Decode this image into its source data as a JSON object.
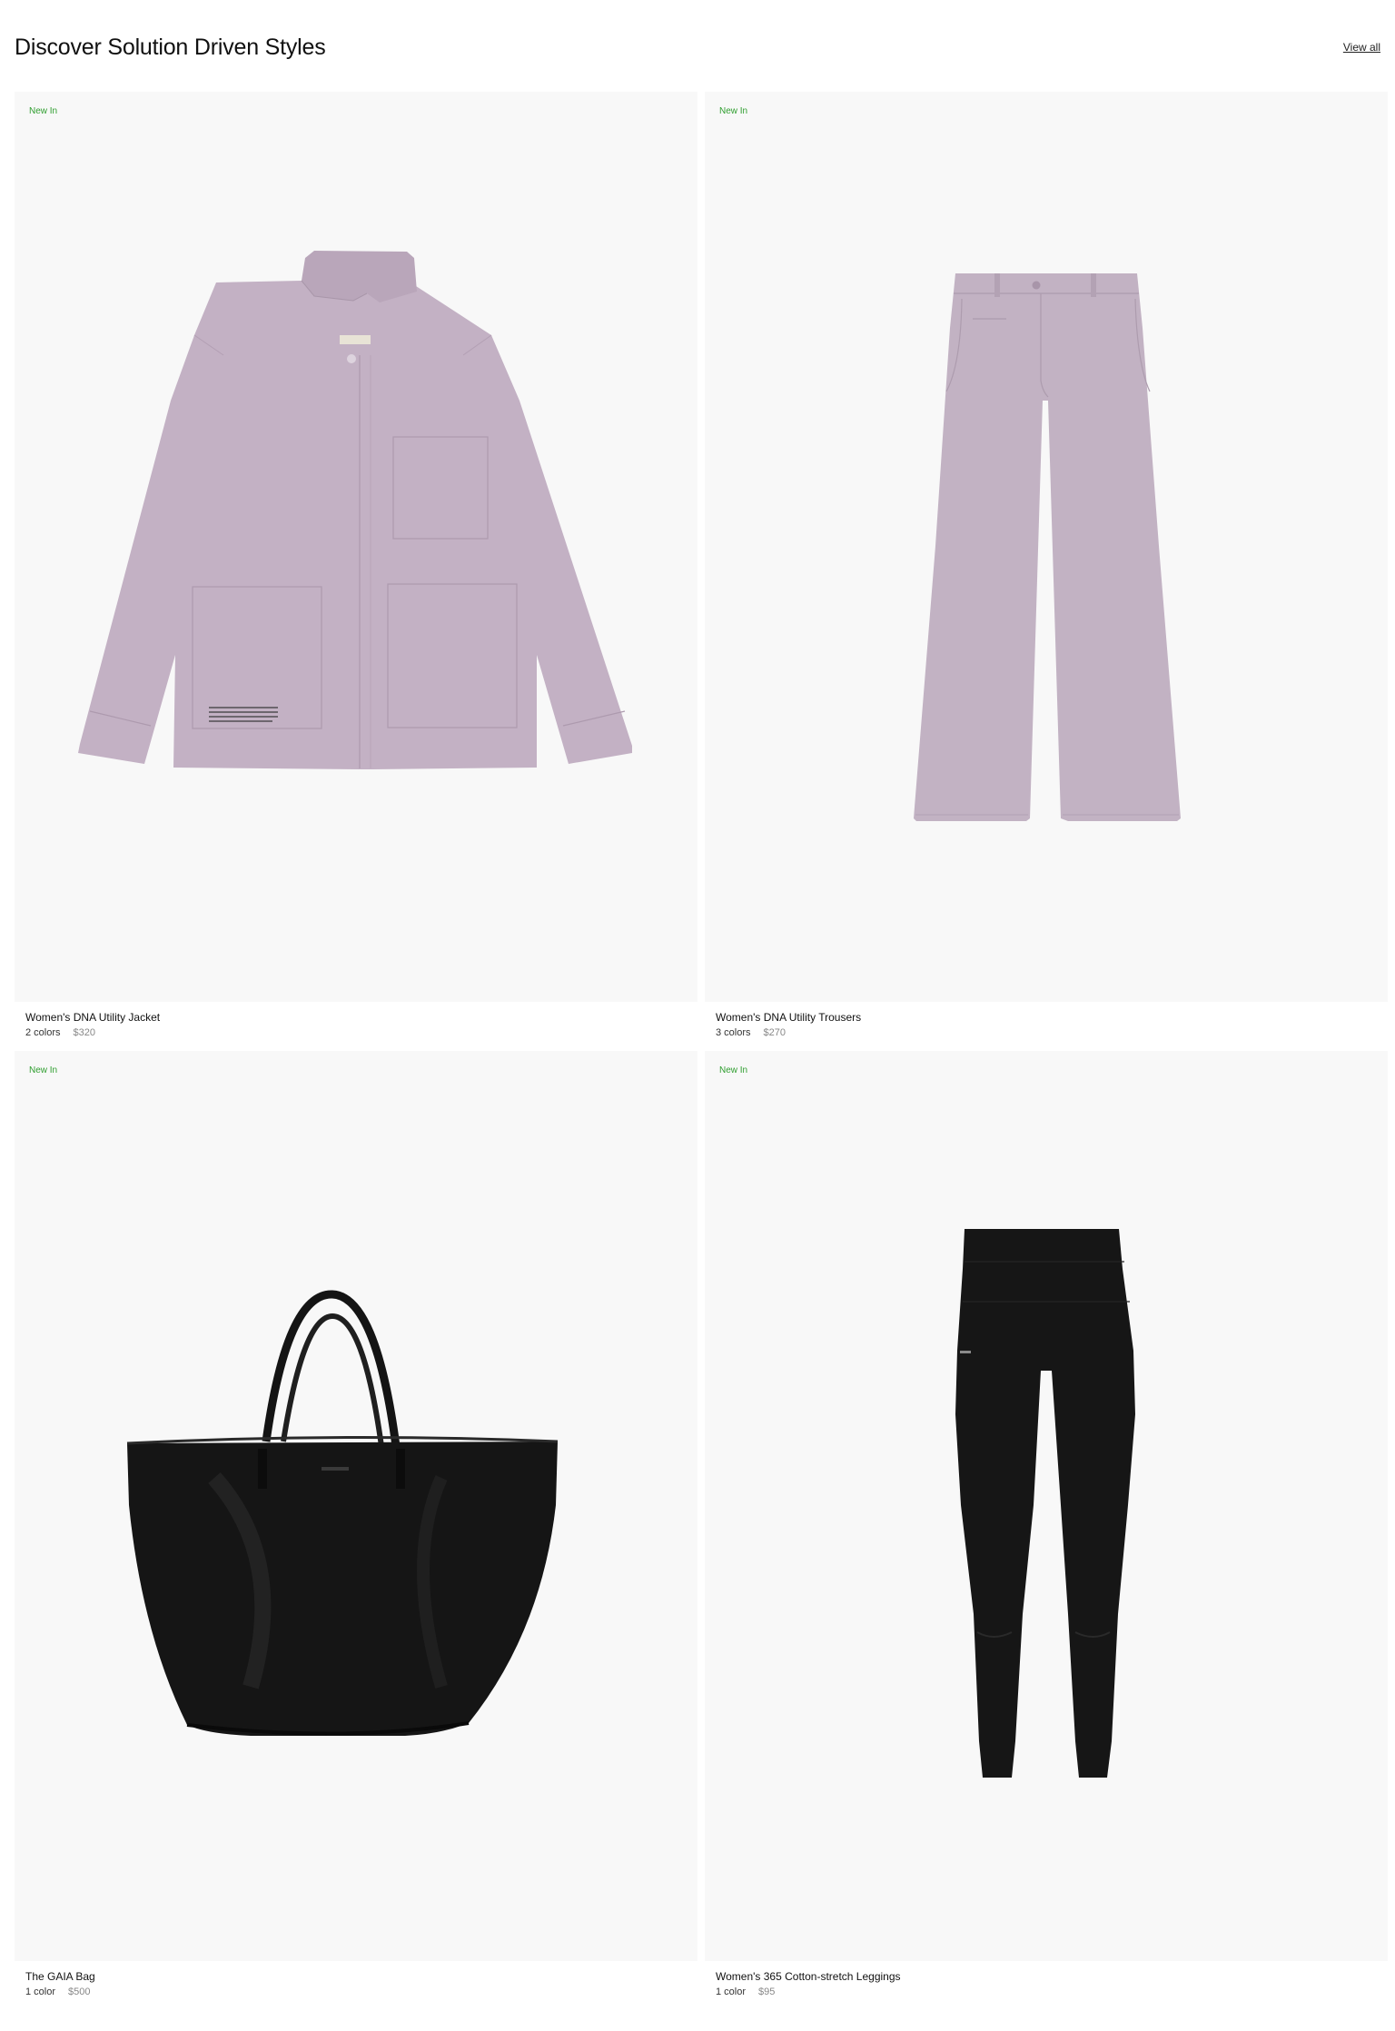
{
  "section": {
    "title": "Discover Solution Driven Styles",
    "view_all_label": "View all"
  },
  "theme": {
    "badge_color": "#2f9e2f",
    "card_bg": "#f8f8f8"
  },
  "products": [
    {
      "badge": "New In",
      "name": "Women's DNA Utility Jacket",
      "colors": "2 colors",
      "price": "$320",
      "icon": "jacket-image",
      "swatch": "#c3b1c4"
    },
    {
      "badge": "New In",
      "name": "Women's DNA Utility Trousers",
      "colors": "3 colors",
      "price": "$270",
      "icon": "trousers-image",
      "swatch": "#c2b2c3"
    },
    {
      "badge": "New In",
      "name": "The GAIA Bag",
      "colors": "1 color",
      "price": "$500",
      "icon": "tote-bag-image",
      "swatch": "#151515"
    },
    {
      "badge": "New In",
      "name": "Women's 365 Cotton-stretch Leggings",
      "colors": "1 color",
      "price": "$95",
      "icon": "leggings-image",
      "swatch": "#161616"
    }
  ]
}
